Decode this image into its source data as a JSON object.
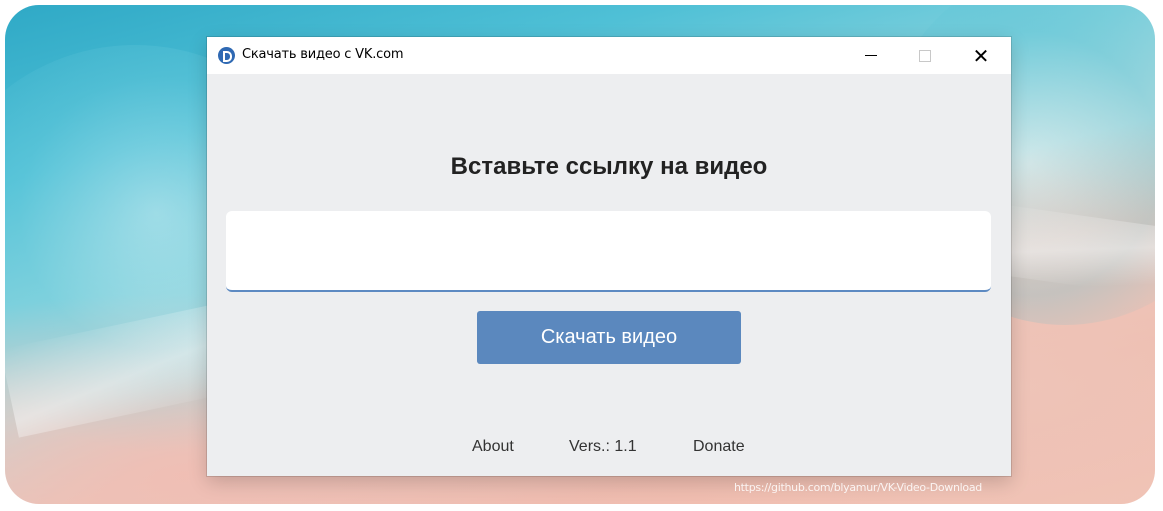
{
  "window": {
    "title": "Скачать видео с VK.com",
    "minimize_icon": "minimize-icon",
    "maximize_icon": "maximize-icon",
    "close_icon": "close-icon"
  },
  "main": {
    "heading": "Вставьте ссылку на видео",
    "url_input_value": "",
    "download_button_label": "Скачать видео"
  },
  "footer": {
    "about_label": "About",
    "version_label": "Vers.: 1.1",
    "donate_label": "Donate"
  },
  "credit": "https://github.com/blyamur/VK-Video-Download",
  "colors": {
    "accent": "#5b88be",
    "window_bg": "#edeef0",
    "input_underline": "#5d8ac2"
  }
}
